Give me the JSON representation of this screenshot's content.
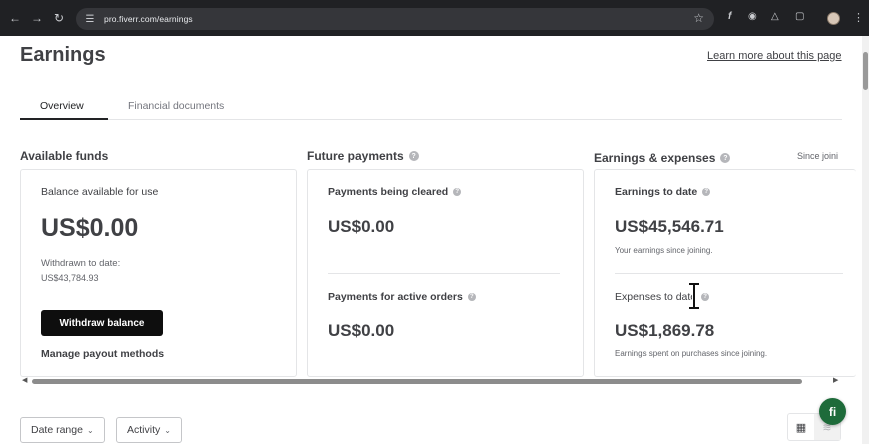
{
  "browser": {
    "url": "pro.fiverr.com/earnings"
  },
  "page": {
    "title": "Earnings",
    "learn_more": "Learn more about this page",
    "tabs": [
      {
        "label": "Overview",
        "active": true
      },
      {
        "label": "Financial documents",
        "active": false
      }
    ]
  },
  "sections": {
    "available_funds": {
      "title": "Available funds",
      "balance_label": "Balance available for use",
      "balance_value": "US$0.00",
      "withdrawn_label": "Withdrawn to date:",
      "withdrawn_value": "US$43,784.93",
      "withdraw_button": "Withdraw balance",
      "manage_payout": "Manage payout methods"
    },
    "future_payments": {
      "title": "Future payments",
      "cleared_label": "Payments being cleared",
      "cleared_value": "US$0.00",
      "active_label": "Payments for active orders",
      "active_value": "US$0.00"
    },
    "earnings_expenses": {
      "title": "Earnings & expenses",
      "since": "Since joini",
      "earnings_label": "Earnings to date",
      "earnings_value": "US$45,546.71",
      "earnings_note": "Your earnings since joining.",
      "expenses_label": "Expenses to date",
      "expenses_value": "US$1,869.78",
      "expenses_note": "Earnings spent on purchases since joining."
    }
  },
  "filters": {
    "date_range": "Date range",
    "activity": "Activity"
  },
  "chat_bubble": "fi",
  "colors": {
    "chrome_bg": "#202124",
    "primary_button": "#0e0e0e",
    "fiverr_green": "#1e6b3a"
  }
}
